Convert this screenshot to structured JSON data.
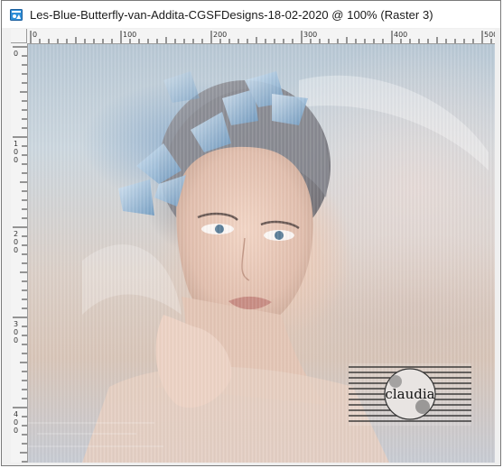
{
  "window": {
    "title": "Les-Blue-Butterfly-van-Addita-CGSFDesigns-18-02-2020 @ 100% (Raster 3)"
  },
  "icons": {
    "app": "image-document-icon"
  },
  "hruler": {
    "labels": [
      "0",
      "100",
      "200",
      "300",
      "400",
      "500"
    ]
  },
  "vruler": {
    "labels": [
      "0",
      "100",
      "200",
      "300",
      "400"
    ]
  },
  "canvas": {
    "description_hidden": "",
    "watermark_text": "claudia"
  }
}
